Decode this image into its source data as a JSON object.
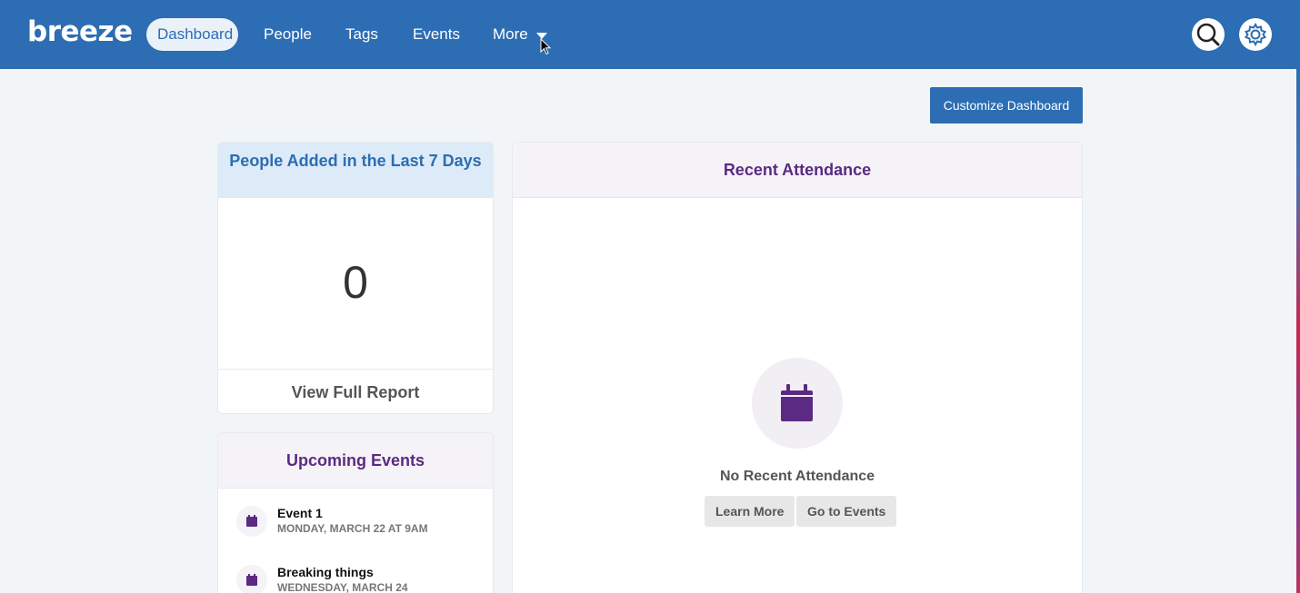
{
  "app": {
    "logo": "breeze"
  },
  "nav": {
    "items": [
      {
        "label": "Dashboard",
        "active": true
      },
      {
        "label": "People",
        "active": false
      },
      {
        "label": "Tags",
        "active": false
      },
      {
        "label": "Events",
        "active": false
      },
      {
        "label": "More",
        "active": false
      }
    ],
    "search_icon": "search-icon",
    "settings_icon": "gear-icon"
  },
  "toolbar": {
    "customize_label": "Customize Dashboard"
  },
  "people_card": {
    "title": "People Added in the Last 7 Days",
    "count": "0",
    "report_link": "View Full Report"
  },
  "events_card": {
    "title": "Upcoming Events",
    "events": [
      {
        "name": "Event 1",
        "date": "MONDAY, MARCH 22 AT 9AM"
      },
      {
        "name": "Breaking things",
        "date": "WEDNESDAY, MARCH 24"
      }
    ],
    "icon": "calendar-icon"
  },
  "attendance_card": {
    "title": "Recent Attendance",
    "empty_text": "No Recent Attendance",
    "learn_more": "Learn More",
    "go_to_events": "Go to Events",
    "icon": "calendar-icon"
  },
  "colors": {
    "brand_blue": "#2d6db3",
    "purple": "#5b2a82",
    "background": "#f1f5f8"
  }
}
